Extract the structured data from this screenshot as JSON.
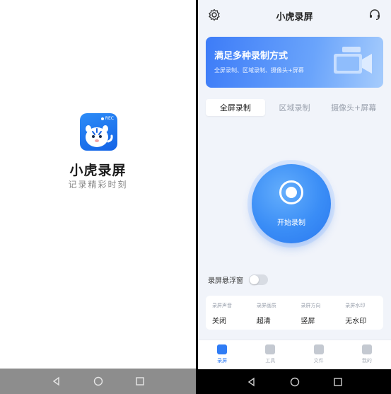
{
  "splash": {
    "logo_badge": "REC",
    "app_name": "小虎录屏",
    "slogan": "记录精彩时刻"
  },
  "main": {
    "header": {
      "title": "小虎录屏",
      "left_icon": "settings-icon",
      "right_icon": "headset-icon"
    },
    "banner": {
      "title": "满足多种录制方式",
      "subtitle": "全屏录制、区域录制、摄像头+屏幕"
    },
    "tabs": [
      {
        "label": "全屏录制",
        "active": true
      },
      {
        "label": "区域录制",
        "active": false
      },
      {
        "label": "摄像头+屏幕",
        "active": false
      }
    ],
    "record_button": {
      "label": "开始录制"
    },
    "floating_window": {
      "label": "录屏悬浮窗",
      "enabled": false
    },
    "settings": [
      {
        "label": "录屏声音",
        "value": "关闭"
      },
      {
        "label": "录屏画质",
        "value": "超清"
      },
      {
        "label": "录屏方向",
        "value": "竖屏"
      },
      {
        "label": "录屏水印",
        "value": "无水印"
      }
    ],
    "bottom_nav": [
      {
        "label": "录屏",
        "icon": "record-icon",
        "active": true
      },
      {
        "label": "工具",
        "icon": "tools-icon",
        "active": false
      },
      {
        "label": "文件",
        "icon": "folder-icon",
        "active": false
      },
      {
        "label": "我的",
        "icon": "profile-icon",
        "active": false
      }
    ]
  },
  "colors": {
    "accent": "#2f7cf5",
    "background": "#f1f4fa"
  }
}
